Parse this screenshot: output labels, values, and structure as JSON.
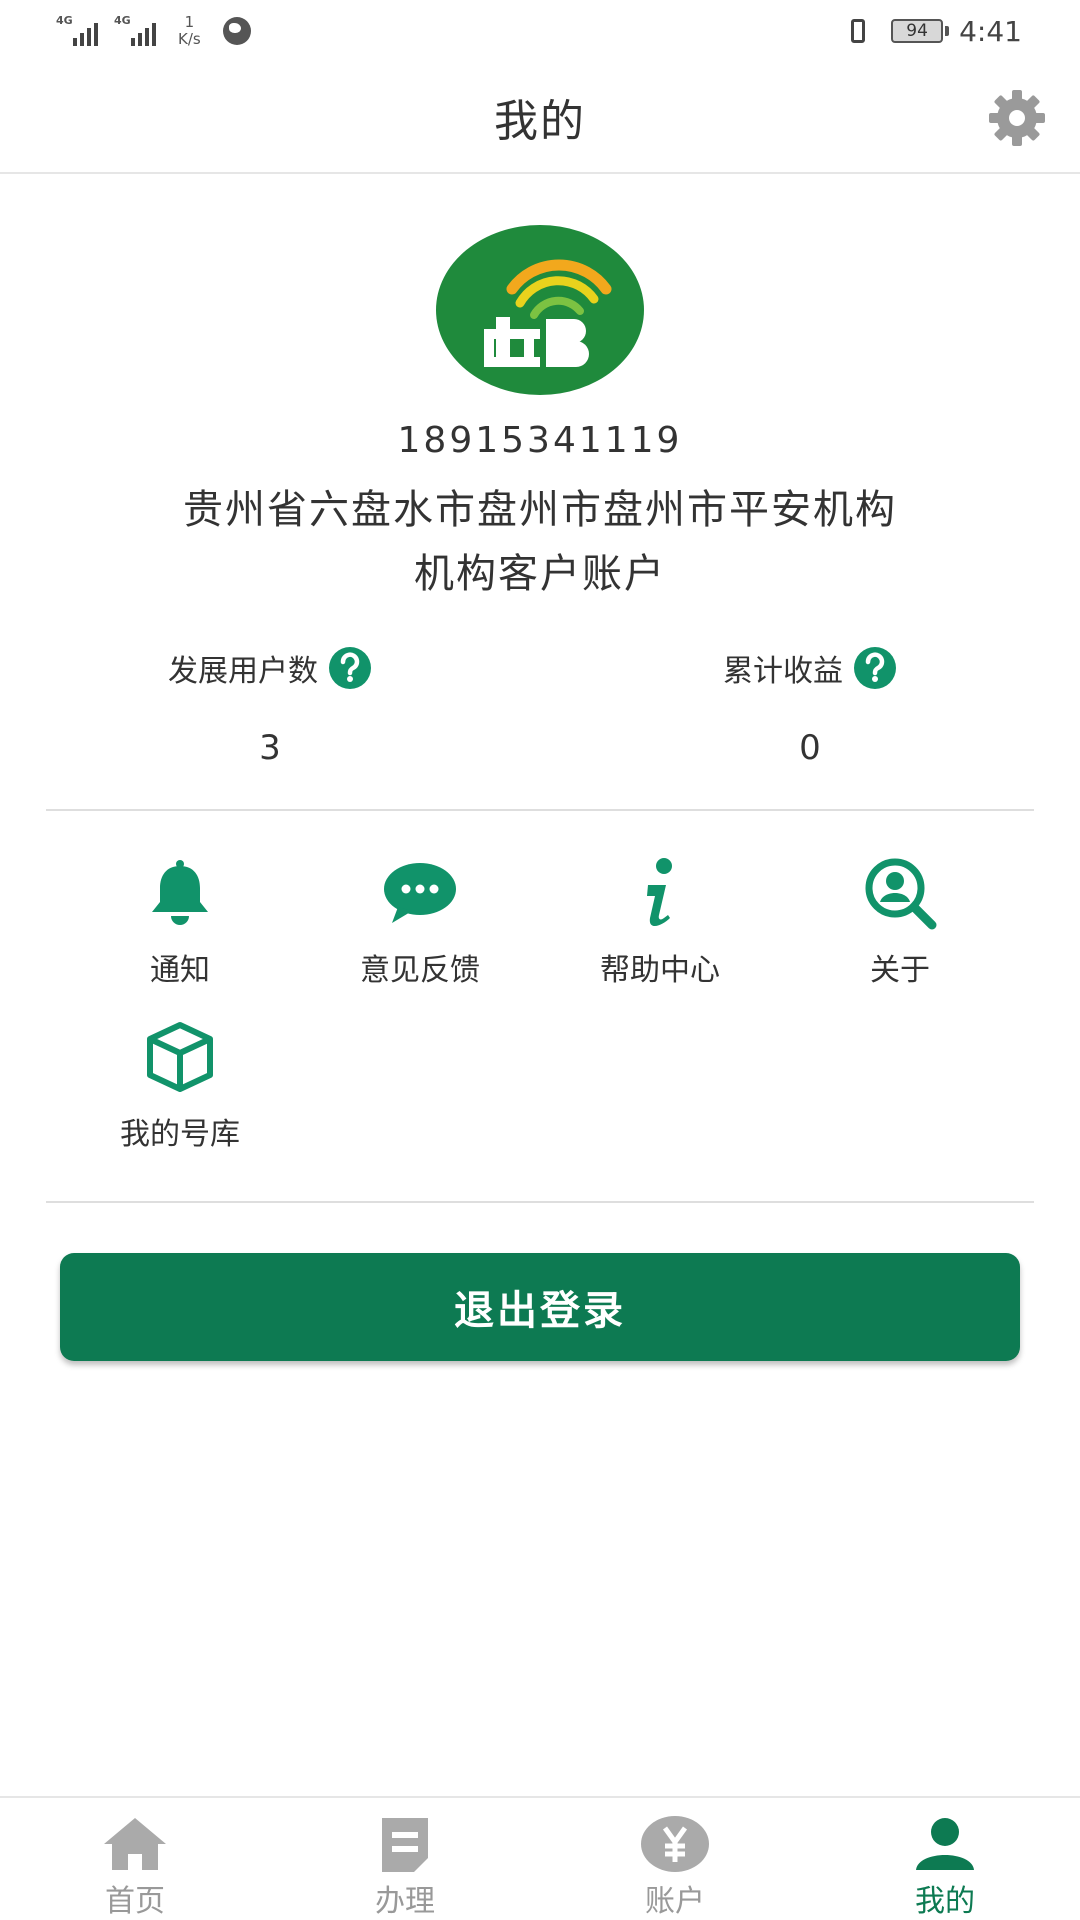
{
  "status_bar": {
    "signal_1": "4G",
    "signal_2": "4G",
    "speed_value": "1",
    "speed_unit": "K/s",
    "battery": "94",
    "time": "4:41"
  },
  "header": {
    "title": "我的",
    "settings_icon": "gear-icon"
  },
  "profile": {
    "avatar_icon": "post-logo",
    "phone": "18915341119",
    "org_line1": "贵州省六盘水市盘州市盘州市平安机构",
    "org_line2": "机构客户账户"
  },
  "stats": {
    "users_label": "发展用户数",
    "users_value": "3",
    "income_label": "累计收益",
    "income_value": "0"
  },
  "menu": [
    {
      "label": "通知",
      "icon": "bell-icon"
    },
    {
      "label": "意见反馈",
      "icon": "chat-icon"
    },
    {
      "label": "帮助中心",
      "icon": "info-icon"
    },
    {
      "label": "关于",
      "icon": "about-search-icon"
    },
    {
      "label": "我的号库",
      "icon": "box-icon"
    }
  ],
  "logout_label": "退出登录",
  "nav": [
    {
      "label": "首页",
      "icon": "home-icon"
    },
    {
      "label": "办理",
      "icon": "document-icon"
    },
    {
      "label": "账户",
      "icon": "yen-icon"
    },
    {
      "label": "我的",
      "icon": "user-icon",
      "active": true
    }
  ],
  "colors": {
    "brand_green": "#0d7a52",
    "icon_green": "#11936a",
    "inactive_gray": "#999999"
  }
}
